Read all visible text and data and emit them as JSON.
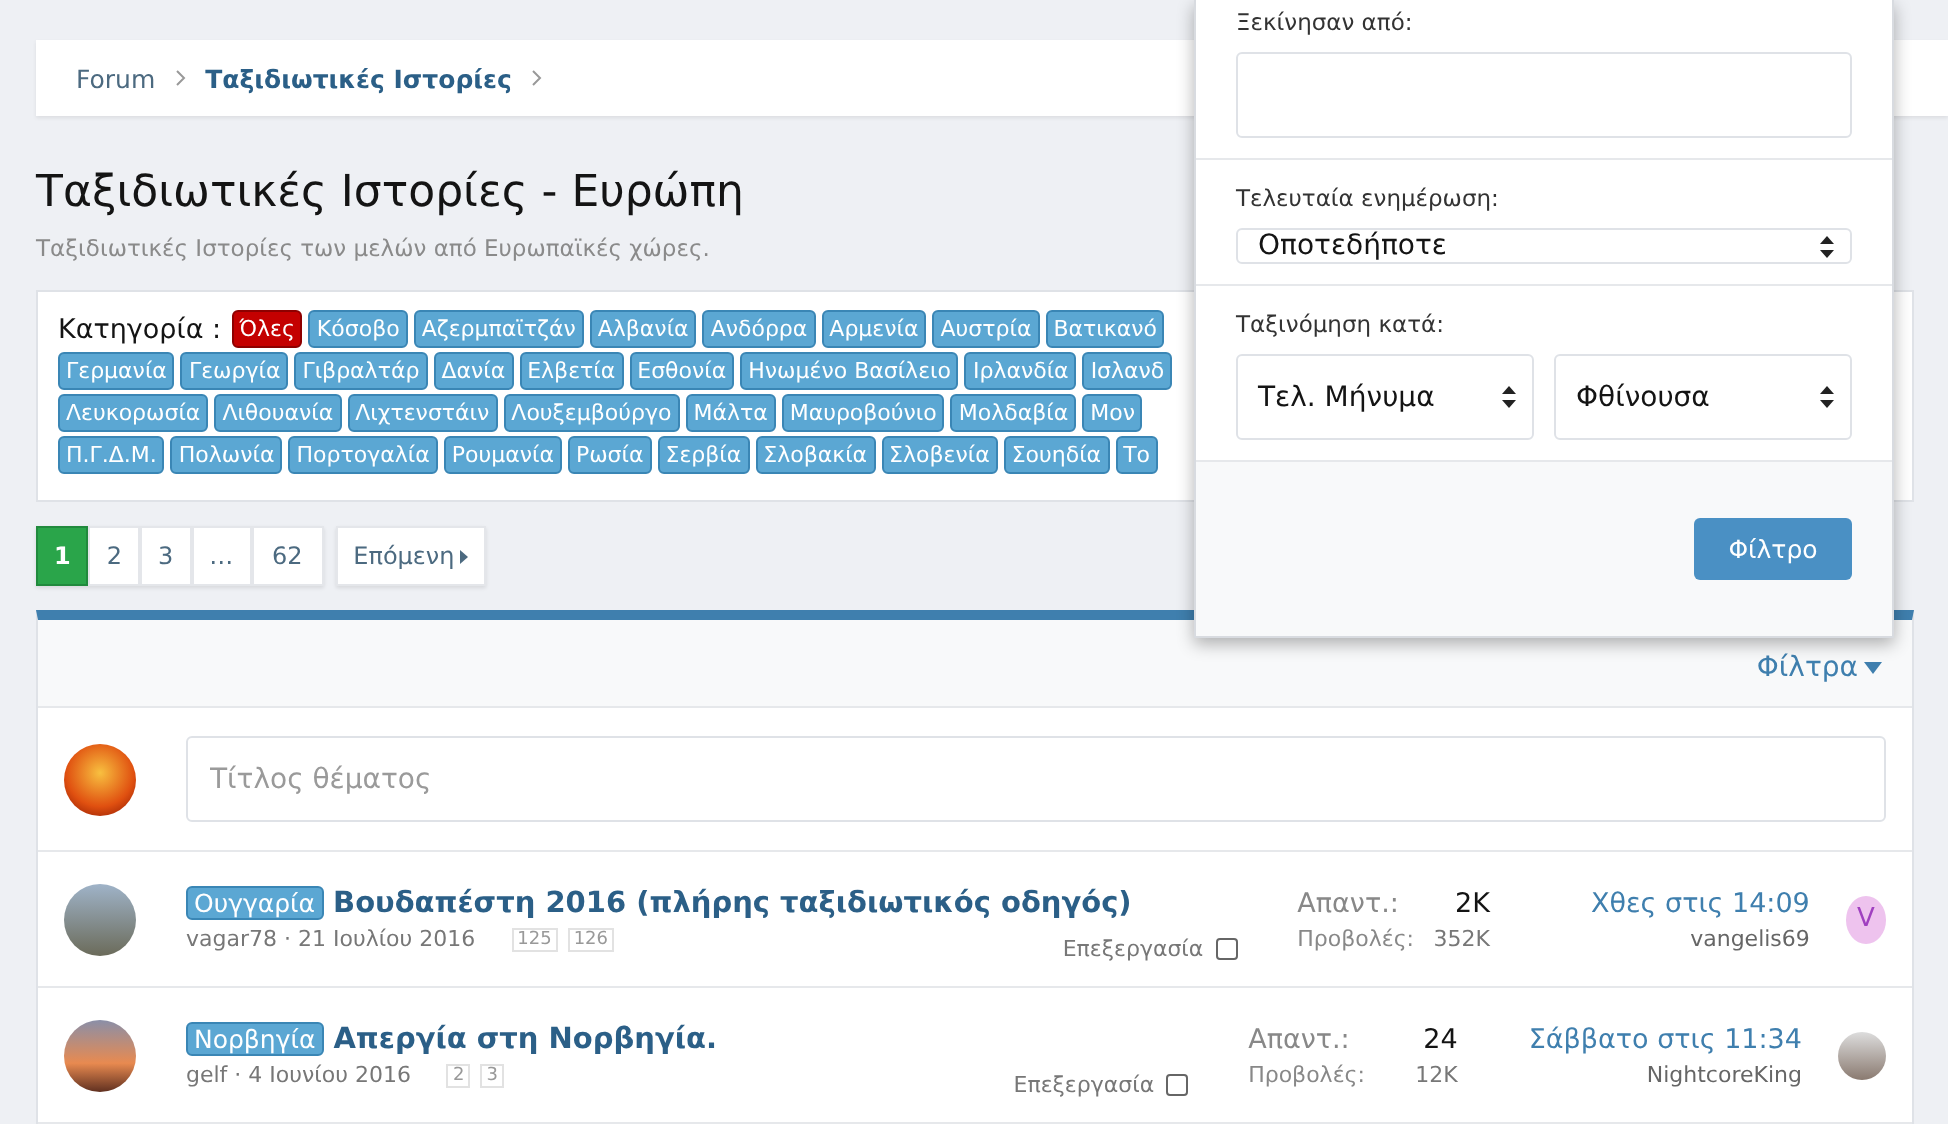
{
  "breadcrumb": [
    {
      "label": "Forum",
      "current": false
    },
    {
      "label": "Ταξιδιωτικές Ιστορίες",
      "current": true
    }
  ],
  "page_title": "Ταξιδιωτικές Ιστορίες - Ευρώπη",
  "page_description": "Ταξιδιωτικές Ιστορίες των μελών από Ευρωπαϊκές χώρες.",
  "category_label": "Κατηγορία :",
  "category_rows": [
    [
      {
        "label": "Όλες",
        "selected": true
      },
      {
        "label": "Κόσοβο",
        "selected": false
      },
      {
        "label": "Αζερμπαϊτζάν",
        "selected": false
      },
      {
        "label": "Αλβανία",
        "selected": false
      },
      {
        "label": "Ανδόρρα",
        "selected": false
      },
      {
        "label": "Αρμενία",
        "selected": false
      },
      {
        "label": "Αυστρία",
        "selected": false
      },
      {
        "label": "Βατικανό",
        "selected": false
      }
    ],
    [
      {
        "label": "Γερμανία",
        "selected": false
      },
      {
        "label": "Γεωργία",
        "selected": false
      },
      {
        "label": "Γιβραλτάρ",
        "selected": false
      },
      {
        "label": "Δανία",
        "selected": false
      },
      {
        "label": "Ελβετία",
        "selected": false
      },
      {
        "label": "Εσθονία",
        "selected": false
      },
      {
        "label": "Ηνωμένο Βασίλειο",
        "selected": false
      },
      {
        "label": "Ιρλανδία",
        "selected": false
      },
      {
        "label": "Ισλανδ",
        "selected": false
      }
    ],
    [
      {
        "label": "Λευκορωσία",
        "selected": false
      },
      {
        "label": "Λιθουανία",
        "selected": false
      },
      {
        "label": "Λιχτενστάιν",
        "selected": false
      },
      {
        "label": "Λουξεμβούργο",
        "selected": false
      },
      {
        "label": "Μάλτα",
        "selected": false
      },
      {
        "label": "Μαυροβούνιο",
        "selected": false
      },
      {
        "label": "Μολδαβία",
        "selected": false
      },
      {
        "label": "Μον",
        "selected": false
      }
    ],
    [
      {
        "label": "Π.Γ.Δ.Μ.",
        "selected": false
      },
      {
        "label": "Πολωνία",
        "selected": false
      },
      {
        "label": "Πορτογαλία",
        "selected": false
      },
      {
        "label": "Ρουμανία",
        "selected": false
      },
      {
        "label": "Ρωσία",
        "selected": false
      },
      {
        "label": "Σερβία",
        "selected": false
      },
      {
        "label": "Σλοβακία",
        "selected": false
      },
      {
        "label": "Σλοβενία",
        "selected": false
      },
      {
        "label": "Σουηδία",
        "selected": false
      },
      {
        "label": "Το",
        "selected": false
      }
    ]
  ],
  "pagination": {
    "pages": [
      {
        "label": "1",
        "selected": true
      },
      {
        "label": "2",
        "selected": false
      },
      {
        "label": "3",
        "selected": false
      },
      {
        "label": "…",
        "selected": false
      },
      {
        "label": "62",
        "selected": false
      }
    ],
    "next": "Επόμενη"
  },
  "filters_toggle": "Φίλτρα",
  "new_thread": {
    "placeholder": "Τίτλος θέματος"
  },
  "threads": [
    {
      "prefix": "Ουγγαρία",
      "title": "Βουδαπέστη 2016 (πλήρης ταξιδιωτικός οδηγός)",
      "meta": "vagar78 · 21 Ιουλίου 2016",
      "pages": [
        "125",
        "126"
      ],
      "edit_label": "Επεξεργασία",
      "edit_checked": false,
      "replies_label": "Απαντ.:",
      "replies": "2K",
      "views_label": "Προβολές:",
      "views": "352K",
      "last_time": "Χθες στις 14:09",
      "last_user": "vangelis69",
      "last_avatar": {
        "kind": "letter",
        "letter": "V"
      }
    },
    {
      "prefix": "Νορβηγία",
      "title": "Απεργία στη Νορβηγία.",
      "meta": "gelf · 4 Ιουνίου 2016",
      "pages": [
        "2",
        "3"
      ],
      "edit_label": "Επεξεργασία",
      "edit_checked": false,
      "replies_label": "Απαντ.:",
      "replies": "24",
      "views_label": "Προβολές:",
      "views": "12K",
      "last_time": "Σάββατο στις 11:34",
      "last_user": "NightcoreKing",
      "last_avatar": {
        "kind": "photo"
      }
    }
  ],
  "filter_menu": {
    "started_by": {
      "label": "Ξεκίνησαν από:"
    },
    "last_update": {
      "label": "Τελευταία ενημέρωση:",
      "value": "Οποτεδήποτε"
    },
    "sort": {
      "label": "Ταξινόμηση κατά:",
      "field": "Τελ. Μήνυμα",
      "order": "Φθίνουσα"
    },
    "submit": "Φίλτρο"
  }
}
